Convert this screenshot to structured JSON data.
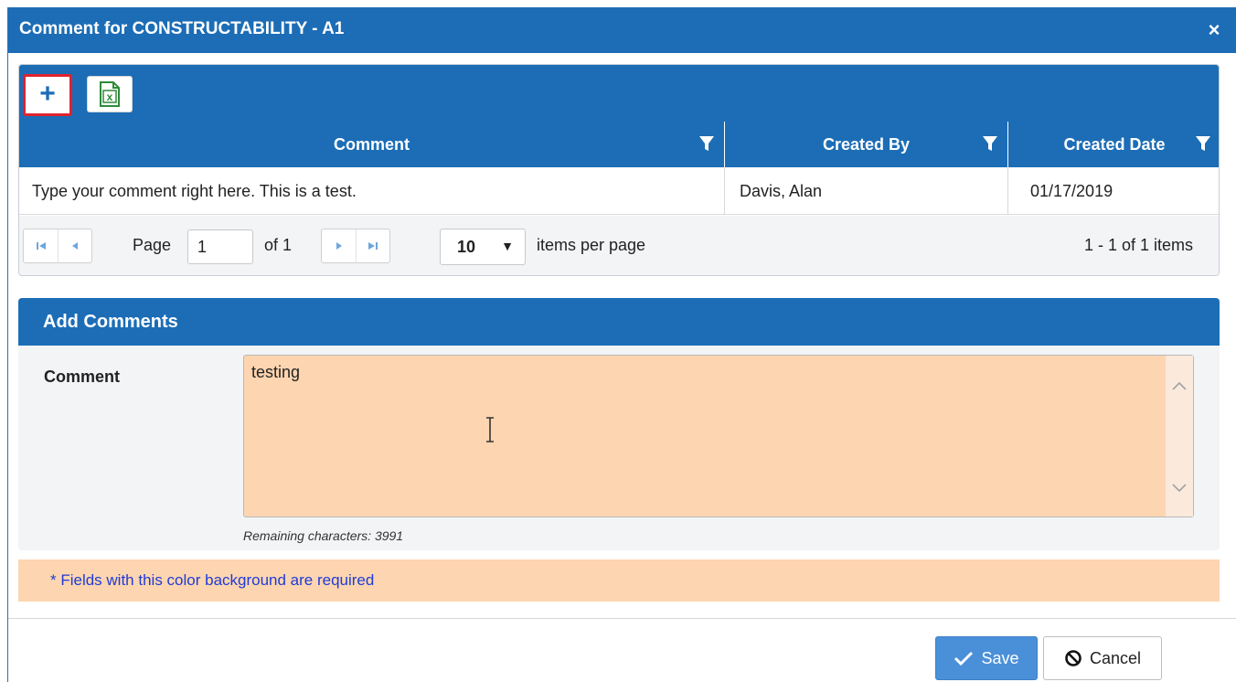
{
  "dialog": {
    "title": "Comment for CONSTRUCTABILITY - A1",
    "close_icon": "close-icon",
    "close_label": "×"
  },
  "toolbar": {
    "add_icon": "plus-icon",
    "add_label": "+",
    "export_icon": "excel-export-icon",
    "export_glyph": "x"
  },
  "grid": {
    "columns": [
      {
        "label": "Comment",
        "filter_icon": "filter-icon"
      },
      {
        "label": "Created By",
        "filter_icon": "filter-icon"
      },
      {
        "label": "Created Date",
        "filter_icon": "filter-icon"
      }
    ],
    "rows": [
      {
        "comment": "Type your comment right here. This is a test.",
        "created_by": "Davis, Alan",
        "created_date": "01/17/2019"
      }
    ]
  },
  "pager": {
    "first_icon": "first-page-icon",
    "prev_icon": "prev-page-icon",
    "next_icon": "next-page-icon",
    "last_icon": "last-page-icon",
    "page_label": "Page",
    "page_value": "1",
    "of_label": "of 1",
    "page_size": "10",
    "page_size_arrow": "▼",
    "items_per_page_label": "items per page",
    "range_label": "1 - 1 of 1 items"
  },
  "add_comments": {
    "header": "Add Comments",
    "comment_label": "Comment",
    "comment_value": "testing",
    "remaining": "Remaining characters: 3991"
  },
  "required_note": "* Fields with this color background are required",
  "buttons": {
    "save_label": "Save",
    "cancel_label": "Cancel"
  },
  "colors": {
    "header_blue": "#1c6db6",
    "required_bg": "#fdd5b0",
    "highlight_red": "#e0232e",
    "save_blue": "#4a90d9",
    "required_text": "#1f3bd6"
  }
}
